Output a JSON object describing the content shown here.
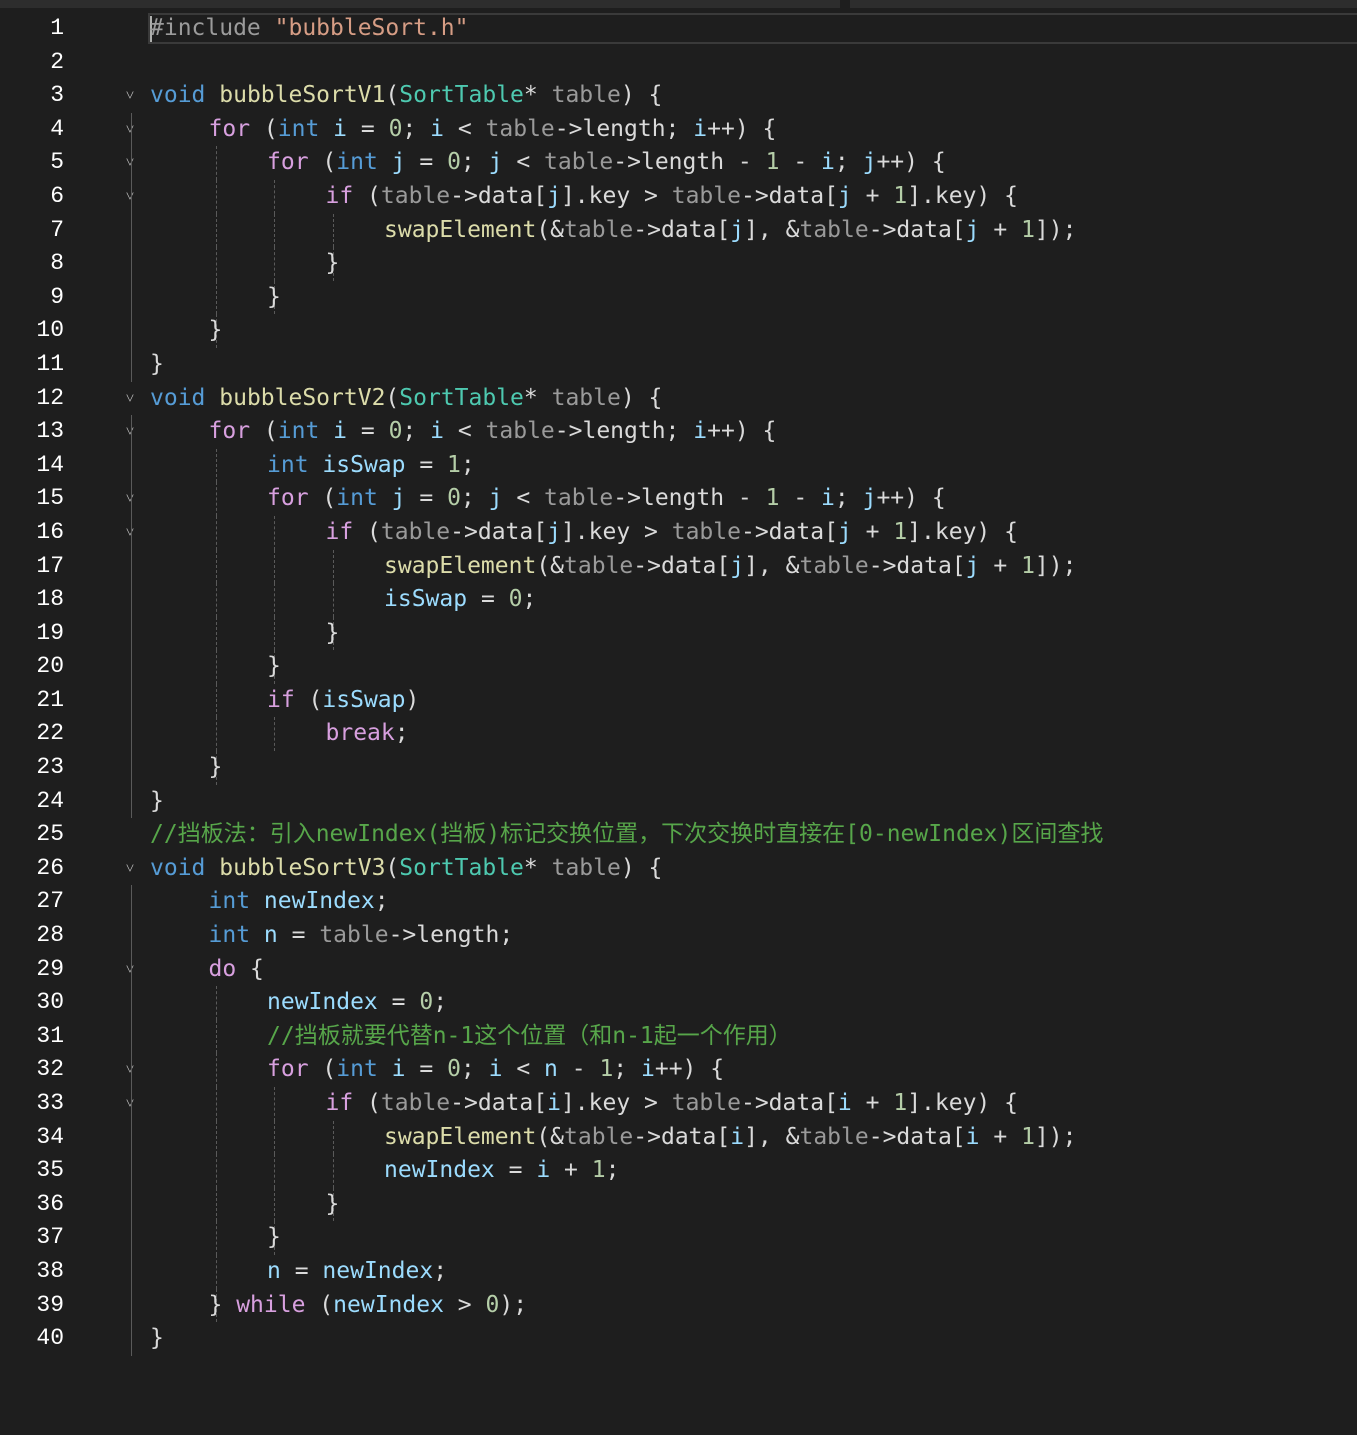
{
  "editor": {
    "language": "C",
    "lines": [
      {
        "n": "1",
        "fold": false,
        "indent": 0,
        "tokens": [
          [
            "pp",
            "#include "
          ],
          [
            "st",
            "\"bubbleSort.h\""
          ]
        ]
      },
      {
        "n": "2",
        "fold": false,
        "indent": 0,
        "tokens": []
      },
      {
        "n": "3",
        "fold": true,
        "indent": 0,
        "tokens": [
          [
            "k",
            "void"
          ],
          [
            "tx",
            " "
          ],
          [
            "fn",
            "bubbleSortV1"
          ],
          [
            "tx",
            "("
          ],
          [
            "ty",
            "SortTable"
          ],
          [
            "tx",
            "* "
          ],
          [
            "pa",
            "table"
          ],
          [
            "tx",
            ") {"
          ]
        ]
      },
      {
        "n": "4",
        "fold": true,
        "indent": 1,
        "tokens": [
          [
            "ctl",
            "for"
          ],
          [
            "tx",
            " ("
          ],
          [
            "k",
            "int"
          ],
          [
            "tx",
            " "
          ],
          [
            "pv",
            "i"
          ],
          [
            "tx",
            " = "
          ],
          [
            "nu",
            "0"
          ],
          [
            "tx",
            "; "
          ],
          [
            "pv",
            "i"
          ],
          [
            "tx",
            " < "
          ],
          [
            "pa",
            "table"
          ],
          [
            "tx",
            "->length; "
          ],
          [
            "pv",
            "i"
          ],
          [
            "tx",
            "++) {"
          ]
        ]
      },
      {
        "n": "5",
        "fold": true,
        "indent": 2,
        "tokens": [
          [
            "ctl",
            "for"
          ],
          [
            "tx",
            " ("
          ],
          [
            "k",
            "int"
          ],
          [
            "tx",
            " "
          ],
          [
            "pv",
            "j"
          ],
          [
            "tx",
            " = "
          ],
          [
            "nu",
            "0"
          ],
          [
            "tx",
            "; "
          ],
          [
            "pv",
            "j"
          ],
          [
            "tx",
            " < "
          ],
          [
            "pa",
            "table"
          ],
          [
            "tx",
            "->length - "
          ],
          [
            "nu",
            "1"
          ],
          [
            "tx",
            " - "
          ],
          [
            "pv",
            "i"
          ],
          [
            "tx",
            "; "
          ],
          [
            "pv",
            "j"
          ],
          [
            "tx",
            "++) {"
          ]
        ]
      },
      {
        "n": "6",
        "fold": true,
        "indent": 3,
        "tokens": [
          [
            "ctl",
            "if"
          ],
          [
            "tx",
            " ("
          ],
          [
            "pa",
            "table"
          ],
          [
            "tx",
            "->data["
          ],
          [
            "pv",
            "j"
          ],
          [
            "tx",
            "].key > "
          ],
          [
            "pa",
            "table"
          ],
          [
            "tx",
            "->data["
          ],
          [
            "pv",
            "j"
          ],
          [
            "tx",
            " + "
          ],
          [
            "nu",
            "1"
          ],
          [
            "tx",
            "].key) {"
          ]
        ]
      },
      {
        "n": "7",
        "fold": false,
        "indent": 4,
        "tokens": [
          [
            "fn",
            "swapElement"
          ],
          [
            "tx",
            "(&"
          ],
          [
            "pa",
            "table"
          ],
          [
            "tx",
            "->data["
          ],
          [
            "pv",
            "j"
          ],
          [
            "tx",
            "], &"
          ],
          [
            "pa",
            "table"
          ],
          [
            "tx",
            "->data["
          ],
          [
            "pv",
            "j"
          ],
          [
            "tx",
            " + "
          ],
          [
            "nu",
            "1"
          ],
          [
            "tx",
            "]);"
          ]
        ]
      },
      {
        "n": "8",
        "fold": false,
        "indent": 3,
        "tokens": [
          [
            "tx",
            "}"
          ]
        ]
      },
      {
        "n": "9",
        "fold": false,
        "indent": 2,
        "tokens": [
          [
            "tx",
            "}"
          ]
        ]
      },
      {
        "n": "10",
        "fold": false,
        "indent": 1,
        "tokens": [
          [
            "tx",
            "}"
          ]
        ]
      },
      {
        "n": "11",
        "fold": false,
        "indent": 0,
        "tokens": [
          [
            "tx",
            "}"
          ]
        ]
      },
      {
        "n": "12",
        "fold": true,
        "indent": 0,
        "tokens": [
          [
            "k",
            "void"
          ],
          [
            "tx",
            " "
          ],
          [
            "fn",
            "bubbleSortV2"
          ],
          [
            "tx",
            "("
          ],
          [
            "ty",
            "SortTable"
          ],
          [
            "tx",
            "* "
          ],
          [
            "pa",
            "table"
          ],
          [
            "tx",
            ") {"
          ]
        ]
      },
      {
        "n": "13",
        "fold": true,
        "indent": 1,
        "tokens": [
          [
            "ctl",
            "for"
          ],
          [
            "tx",
            " ("
          ],
          [
            "k",
            "int"
          ],
          [
            "tx",
            " "
          ],
          [
            "pv",
            "i"
          ],
          [
            "tx",
            " = "
          ],
          [
            "nu",
            "0"
          ],
          [
            "tx",
            "; "
          ],
          [
            "pv",
            "i"
          ],
          [
            "tx",
            " < "
          ],
          [
            "pa",
            "table"
          ],
          [
            "tx",
            "->length; "
          ],
          [
            "pv",
            "i"
          ],
          [
            "tx",
            "++) {"
          ]
        ]
      },
      {
        "n": "14",
        "fold": false,
        "indent": 2,
        "tokens": [
          [
            "k",
            "int"
          ],
          [
            "tx",
            " "
          ],
          [
            "pv",
            "isSwap"
          ],
          [
            "tx",
            " = "
          ],
          [
            "nu",
            "1"
          ],
          [
            "tx",
            ";"
          ]
        ]
      },
      {
        "n": "15",
        "fold": true,
        "indent": 2,
        "tokens": [
          [
            "ctl",
            "for"
          ],
          [
            "tx",
            " ("
          ],
          [
            "k",
            "int"
          ],
          [
            "tx",
            " "
          ],
          [
            "pv",
            "j"
          ],
          [
            "tx",
            " = "
          ],
          [
            "nu",
            "0"
          ],
          [
            "tx",
            "; "
          ],
          [
            "pv",
            "j"
          ],
          [
            "tx",
            " < "
          ],
          [
            "pa",
            "table"
          ],
          [
            "tx",
            "->length - "
          ],
          [
            "nu",
            "1"
          ],
          [
            "tx",
            " - "
          ],
          [
            "pv",
            "i"
          ],
          [
            "tx",
            "; "
          ],
          [
            "pv",
            "j"
          ],
          [
            "tx",
            "++) {"
          ]
        ]
      },
      {
        "n": "16",
        "fold": true,
        "indent": 3,
        "tokens": [
          [
            "ctl",
            "if"
          ],
          [
            "tx",
            " ("
          ],
          [
            "pa",
            "table"
          ],
          [
            "tx",
            "->data["
          ],
          [
            "pv",
            "j"
          ],
          [
            "tx",
            "].key > "
          ],
          [
            "pa",
            "table"
          ],
          [
            "tx",
            "->data["
          ],
          [
            "pv",
            "j"
          ],
          [
            "tx",
            " + "
          ],
          [
            "nu",
            "1"
          ],
          [
            "tx",
            "].key) {"
          ]
        ]
      },
      {
        "n": "17",
        "fold": false,
        "indent": 4,
        "tokens": [
          [
            "fn",
            "swapElement"
          ],
          [
            "tx",
            "(&"
          ],
          [
            "pa",
            "table"
          ],
          [
            "tx",
            "->data["
          ],
          [
            "pv",
            "j"
          ],
          [
            "tx",
            "], &"
          ],
          [
            "pa",
            "table"
          ],
          [
            "tx",
            "->data["
          ],
          [
            "pv",
            "j"
          ],
          [
            "tx",
            " + "
          ],
          [
            "nu",
            "1"
          ],
          [
            "tx",
            "]);"
          ]
        ]
      },
      {
        "n": "18",
        "fold": false,
        "indent": 4,
        "tokens": [
          [
            "pv",
            "isSwap"
          ],
          [
            "tx",
            " = "
          ],
          [
            "nu",
            "0"
          ],
          [
            "tx",
            ";"
          ]
        ]
      },
      {
        "n": "19",
        "fold": false,
        "indent": 3,
        "tokens": [
          [
            "tx",
            "}"
          ]
        ]
      },
      {
        "n": "20",
        "fold": false,
        "indent": 2,
        "tokens": [
          [
            "tx",
            "}"
          ]
        ]
      },
      {
        "n": "21",
        "fold": false,
        "indent": 2,
        "tokens": [
          [
            "ctl",
            "if"
          ],
          [
            "tx",
            " ("
          ],
          [
            "pv",
            "isSwap"
          ],
          [
            "tx",
            ")"
          ]
        ]
      },
      {
        "n": "22",
        "fold": false,
        "indent": 3,
        "tokens": [
          [
            "ctl",
            "break"
          ],
          [
            "tx",
            ";"
          ]
        ]
      },
      {
        "n": "23",
        "fold": false,
        "indent": 1,
        "tokens": [
          [
            "tx",
            "}"
          ]
        ]
      },
      {
        "n": "24",
        "fold": false,
        "indent": 0,
        "tokens": [
          [
            "tx",
            "}"
          ]
        ]
      },
      {
        "n": "25",
        "fold": false,
        "indent": 0,
        "tokens": [
          [
            "cm",
            "//挡板法：引入newIndex(挡板)标记交换位置，下次交换时直接在[0-newIndex)区间查找"
          ]
        ]
      },
      {
        "n": "26",
        "fold": true,
        "indent": 0,
        "tokens": [
          [
            "k",
            "void"
          ],
          [
            "tx",
            " "
          ],
          [
            "fn",
            "bubbleSortV3"
          ],
          [
            "tx",
            "("
          ],
          [
            "ty",
            "SortTable"
          ],
          [
            "tx",
            "* "
          ],
          [
            "pa",
            "table"
          ],
          [
            "tx",
            ") {"
          ]
        ]
      },
      {
        "n": "27",
        "fold": false,
        "indent": 1,
        "tokens": [
          [
            "k",
            "int"
          ],
          [
            "tx",
            " "
          ],
          [
            "pv",
            "newIndex"
          ],
          [
            "tx",
            ";"
          ]
        ]
      },
      {
        "n": "28",
        "fold": false,
        "indent": 1,
        "tokens": [
          [
            "k",
            "int"
          ],
          [
            "tx",
            " "
          ],
          [
            "pv",
            "n"
          ],
          [
            "tx",
            " = "
          ],
          [
            "pa",
            "table"
          ],
          [
            "tx",
            "->length;"
          ]
        ]
      },
      {
        "n": "29",
        "fold": true,
        "indent": 1,
        "tokens": [
          [
            "ctl",
            "do"
          ],
          [
            "tx",
            " {"
          ]
        ]
      },
      {
        "n": "30",
        "fold": false,
        "indent": 2,
        "tokens": [
          [
            "pv",
            "newIndex"
          ],
          [
            "tx",
            " = "
          ],
          [
            "nu",
            "0"
          ],
          [
            "tx",
            ";"
          ]
        ]
      },
      {
        "n": "31",
        "fold": false,
        "indent": 2,
        "tokens": [
          [
            "cm",
            "//挡板就要代替n-1这个位置（和n-1起一个作用）"
          ]
        ]
      },
      {
        "n": "32",
        "fold": true,
        "indent": 2,
        "tokens": [
          [
            "ctl",
            "for"
          ],
          [
            "tx",
            " ("
          ],
          [
            "k",
            "int"
          ],
          [
            "tx",
            " "
          ],
          [
            "pv",
            "i"
          ],
          [
            "tx",
            " = "
          ],
          [
            "nu",
            "0"
          ],
          [
            "tx",
            "; "
          ],
          [
            "pv",
            "i"
          ],
          [
            "tx",
            " < "
          ],
          [
            "pv",
            "n"
          ],
          [
            "tx",
            " - "
          ],
          [
            "nu",
            "1"
          ],
          [
            "tx",
            "; "
          ],
          [
            "pv",
            "i"
          ],
          [
            "tx",
            "++) {"
          ]
        ]
      },
      {
        "n": "33",
        "fold": true,
        "indent": 3,
        "tokens": [
          [
            "ctl",
            "if"
          ],
          [
            "tx",
            " ("
          ],
          [
            "pa",
            "table"
          ],
          [
            "tx",
            "->data["
          ],
          [
            "pv",
            "i"
          ],
          [
            "tx",
            "].key > "
          ],
          [
            "pa",
            "table"
          ],
          [
            "tx",
            "->data["
          ],
          [
            "pv",
            "i"
          ],
          [
            "tx",
            " + "
          ],
          [
            "nu",
            "1"
          ],
          [
            "tx",
            "].key) {"
          ]
        ]
      },
      {
        "n": "34",
        "fold": false,
        "indent": 4,
        "tokens": [
          [
            "fn",
            "swapElement"
          ],
          [
            "tx",
            "(&"
          ],
          [
            "pa",
            "table"
          ],
          [
            "tx",
            "->data["
          ],
          [
            "pv",
            "i"
          ],
          [
            "tx",
            "], &"
          ],
          [
            "pa",
            "table"
          ],
          [
            "tx",
            "->data["
          ],
          [
            "pv",
            "i"
          ],
          [
            "tx",
            " + "
          ],
          [
            "nu",
            "1"
          ],
          [
            "tx",
            "]);"
          ]
        ]
      },
      {
        "n": "35",
        "fold": false,
        "indent": 4,
        "tokens": [
          [
            "pv",
            "newIndex"
          ],
          [
            "tx",
            " = "
          ],
          [
            "pv",
            "i"
          ],
          [
            "tx",
            " + "
          ],
          [
            "nu",
            "1"
          ],
          [
            "tx",
            ";"
          ]
        ]
      },
      {
        "n": "36",
        "fold": false,
        "indent": 3,
        "tokens": [
          [
            "tx",
            "}"
          ]
        ]
      },
      {
        "n": "37",
        "fold": false,
        "indent": 2,
        "tokens": [
          [
            "tx",
            "}"
          ]
        ]
      },
      {
        "n": "38",
        "fold": false,
        "indent": 2,
        "tokens": [
          [
            "pv",
            "n"
          ],
          [
            "tx",
            " = "
          ],
          [
            "pv",
            "newIndex"
          ],
          [
            "tx",
            ";"
          ]
        ]
      },
      {
        "n": "39",
        "fold": false,
        "indent": 1,
        "tokens": [
          [
            "tx",
            "} "
          ],
          [
            "ctl",
            "while"
          ],
          [
            "tx",
            " ("
          ],
          [
            "pv",
            "newIndex"
          ],
          [
            "tx",
            " > "
          ],
          [
            "nu",
            "0"
          ],
          [
            "tx",
            ");"
          ]
        ]
      },
      {
        "n": "40",
        "fold": false,
        "indent": 0,
        "tokens": [
          [
            "tx",
            "}"
          ]
        ]
      }
    ]
  }
}
